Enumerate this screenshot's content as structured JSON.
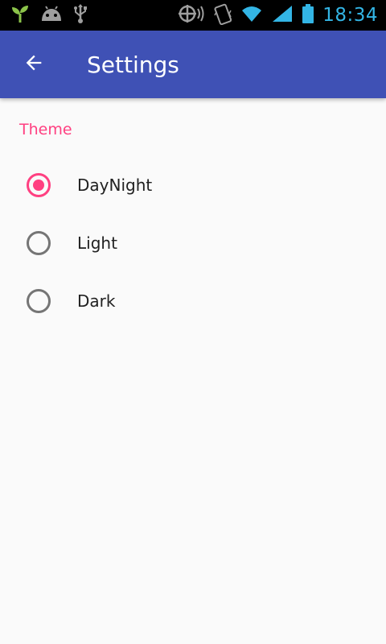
{
  "status_bar": {
    "time": "18:34",
    "icons": [
      "sprout-icon",
      "android-icon",
      "usb-icon",
      "nfc-icon",
      "vibrate-icon",
      "wifi-icon",
      "signal-icon",
      "battery-icon"
    ]
  },
  "app_bar": {
    "back_icon": "arrow-back-icon",
    "title": "Settings"
  },
  "theme": {
    "header": "Theme",
    "options": [
      {
        "label": "DayNight",
        "selected": true
      },
      {
        "label": "Light",
        "selected": false
      },
      {
        "label": "Dark",
        "selected": false
      }
    ]
  },
  "colors": {
    "primary": "#3f51b5",
    "accent": "#ff4081",
    "status_time": "#33b5e5"
  }
}
